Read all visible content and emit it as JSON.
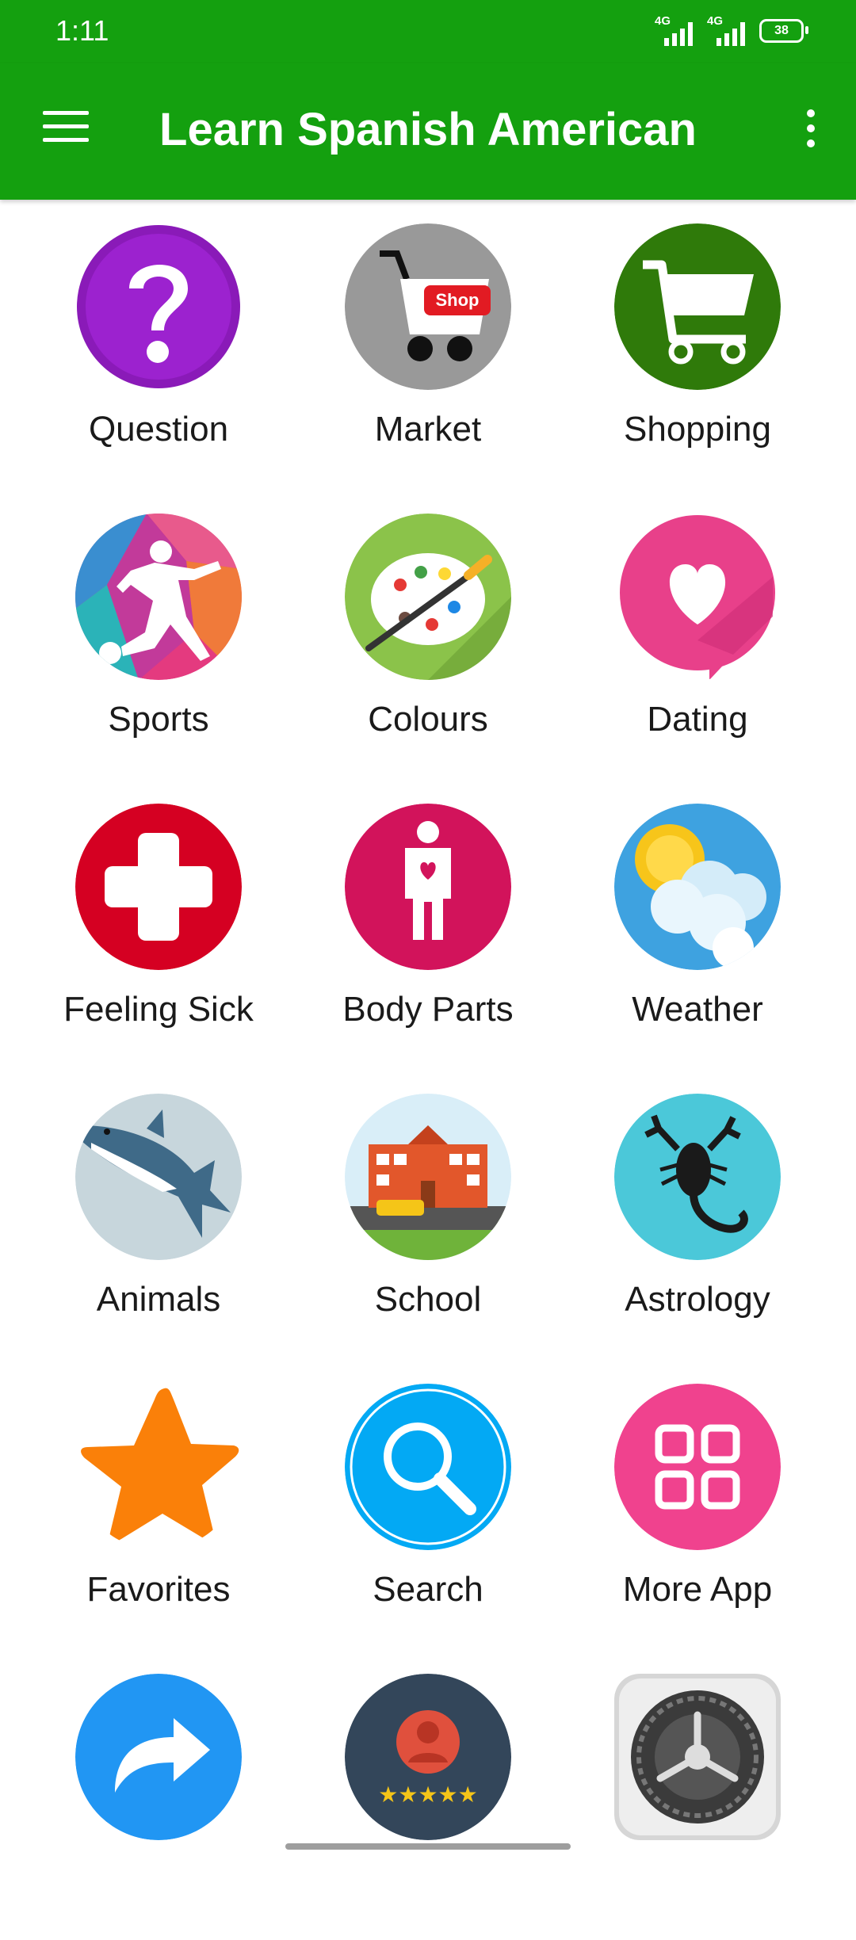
{
  "status": {
    "time": "1:11",
    "sim1": "4G",
    "sim2": "4G",
    "battery": "38"
  },
  "appbar": {
    "title": "Learn Spanish American",
    "menu_icon": "hamburger-menu-icon",
    "more_icon": "more-vert-icon"
  },
  "tiles": [
    {
      "label": "Question",
      "icon": "question-icon"
    },
    {
      "label": "Market",
      "icon": "shop-cart-icon"
    },
    {
      "label": "Shopping",
      "icon": "shopping-cart-icon"
    },
    {
      "label": "Sports",
      "icon": "soccer-player-icon"
    },
    {
      "label": "Colours",
      "icon": "paint-palette-icon"
    },
    {
      "label": "Dating",
      "icon": "heart-chat-icon"
    },
    {
      "label": "Feeling Sick",
      "icon": "medical-cross-icon"
    },
    {
      "label": "Body Parts",
      "icon": "body-figure-icon"
    },
    {
      "label": "Weather",
      "icon": "sun-cloud-icon"
    },
    {
      "label": "Animals",
      "icon": "shark-icon"
    },
    {
      "label": "School",
      "icon": "school-building-icon"
    },
    {
      "label": "Astrology",
      "icon": "scorpion-icon"
    },
    {
      "label": "Favorites",
      "icon": "star-icon"
    },
    {
      "label": "Search",
      "icon": "magnifier-icon"
    },
    {
      "label": "More App",
      "icon": "grid-apps-icon"
    },
    {
      "label": "",
      "icon": "share-arrow-icon"
    },
    {
      "label": "",
      "icon": "rate-user-icon"
    },
    {
      "label": "",
      "icon": "settings-gear-icon"
    }
  ],
  "colors": {
    "primary": "#14a00f",
    "text": "#1a1a1a"
  }
}
